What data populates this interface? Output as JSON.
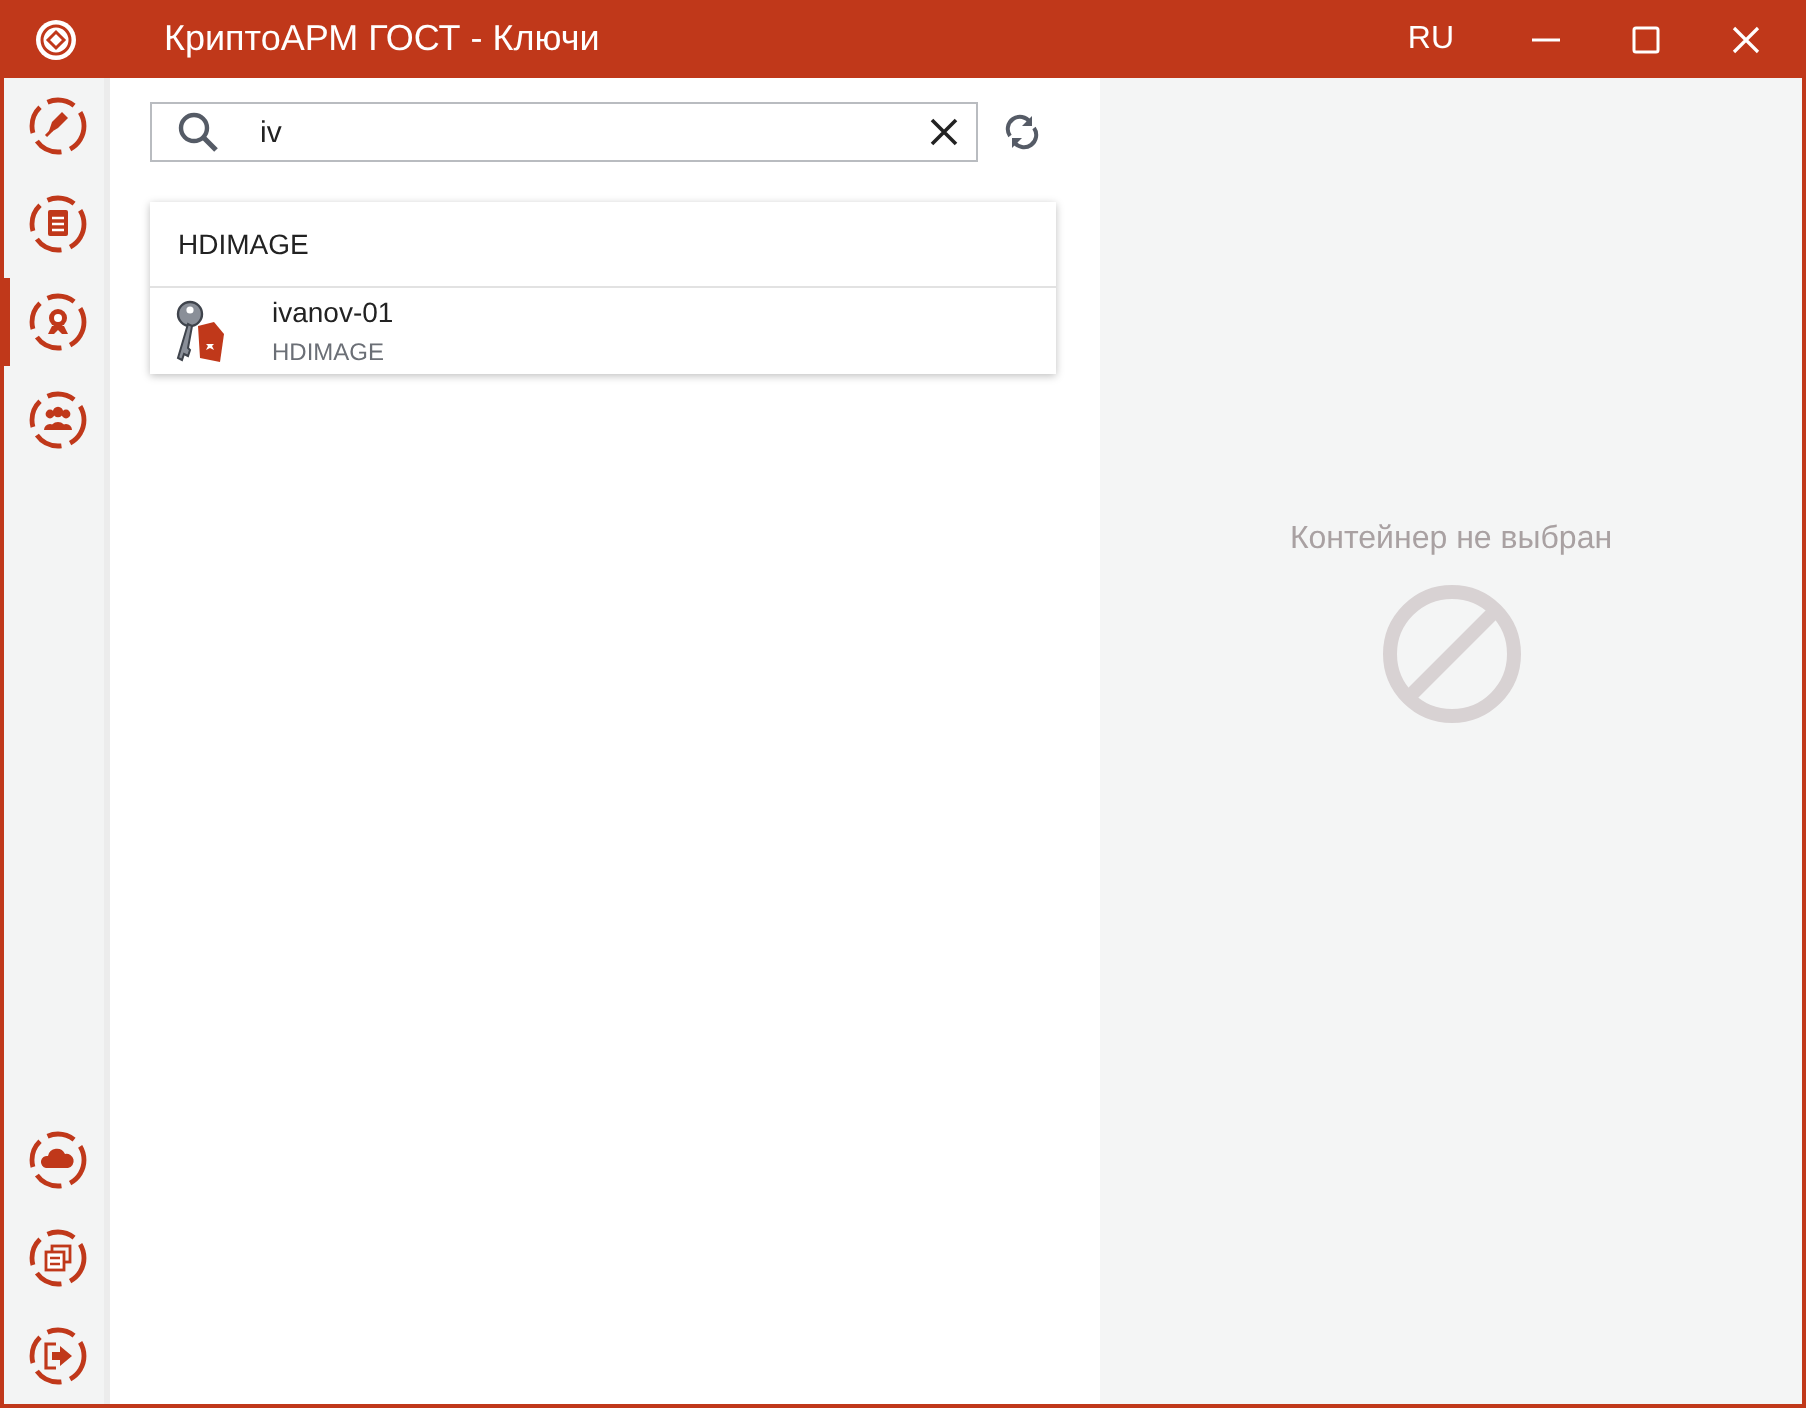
{
  "window": {
    "title": "КриптоАРМ ГОСТ - Ключи",
    "language": "RU"
  },
  "sidebar": {
    "top_items": [
      {
        "kind": "pen",
        "selected": false
      },
      {
        "kind": "document",
        "selected": false
      },
      {
        "kind": "certificate",
        "selected": true
      },
      {
        "kind": "people",
        "selected": false
      }
    ],
    "bottom_items": [
      {
        "kind": "cloud",
        "selected": false
      },
      {
        "kind": "journal",
        "selected": false
      },
      {
        "kind": "exit",
        "selected": false
      }
    ]
  },
  "search": {
    "value": "iv"
  },
  "key_list": {
    "groups": [
      {
        "title": "HDIMAGE",
        "items": [
          {
            "name": "ivanov-01",
            "storage": "HDIMAGE"
          }
        ]
      }
    ]
  },
  "details": {
    "empty_message": "Контейнер не выбран"
  }
}
